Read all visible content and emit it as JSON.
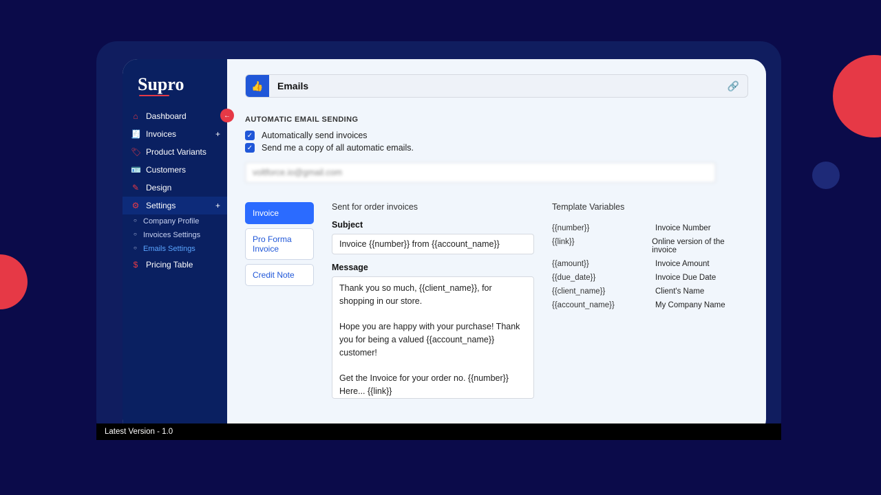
{
  "logo": "Supro",
  "sidebar": {
    "items": [
      {
        "icon": "⌂",
        "label": "Dashboard"
      },
      {
        "icon": "🧾",
        "label": "Invoices",
        "plus": true
      },
      {
        "icon": "🏷",
        "label": "Product Variants"
      },
      {
        "icon": "🪪",
        "label": "Customers"
      },
      {
        "icon": "✎",
        "label": "Design"
      },
      {
        "icon": "⚙",
        "label": "Settings",
        "plus": true,
        "active": true
      },
      {
        "icon": "$",
        "label": "Pricing Table"
      }
    ],
    "subs": [
      {
        "label": "Company Profile"
      },
      {
        "label": "Invoices Settings"
      },
      {
        "label": "Emails Settings",
        "active": true
      }
    ]
  },
  "header": {
    "title": "Emails"
  },
  "section_title": "AUTOMATIC EMAIL SENDING",
  "checks": [
    {
      "label": "Automatically send invoices",
      "checked": true
    },
    {
      "label": "Send me a copy of all automatic emails.",
      "checked": true
    }
  ],
  "email_value": "voltforce.io@gmail.com",
  "tabs": [
    {
      "label": "Invoice",
      "sel": true
    },
    {
      "label": "Pro Forma Invoice"
    },
    {
      "label": "Credit Note"
    }
  ],
  "form": {
    "desc": "Sent for order invoices",
    "subject_label": "Subject",
    "subject": "Invoice {{number}} from {{account_name}}",
    "message_label": "Message",
    "message": "Thank you so much, {{client_name}}, for shopping in our store.\n\nHope you are happy with your purchase! Thank you for being a valued {{account_name}} customer!\n\nGet the Invoice for your order no. {{number}} Here... {{link}}\n\nBest Regards\n{{account_name}}"
  },
  "vars_title": "Template Variables",
  "vars": [
    {
      "k": "{{number}}",
      "v": "Invoice Number"
    },
    {
      "k": "{{link}}",
      "v": "Online version of the invoice"
    },
    {
      "k": "{{amount}}",
      "v": "Invoice Amount"
    },
    {
      "k": "{{due_date}}",
      "v": "Invoice Due Date"
    },
    {
      "k": "{{client_name}}",
      "v": "Client's Name"
    },
    {
      "k": "{{account_name}}",
      "v": "My Company Name"
    }
  ],
  "footer": "Latest Version - 1.0"
}
